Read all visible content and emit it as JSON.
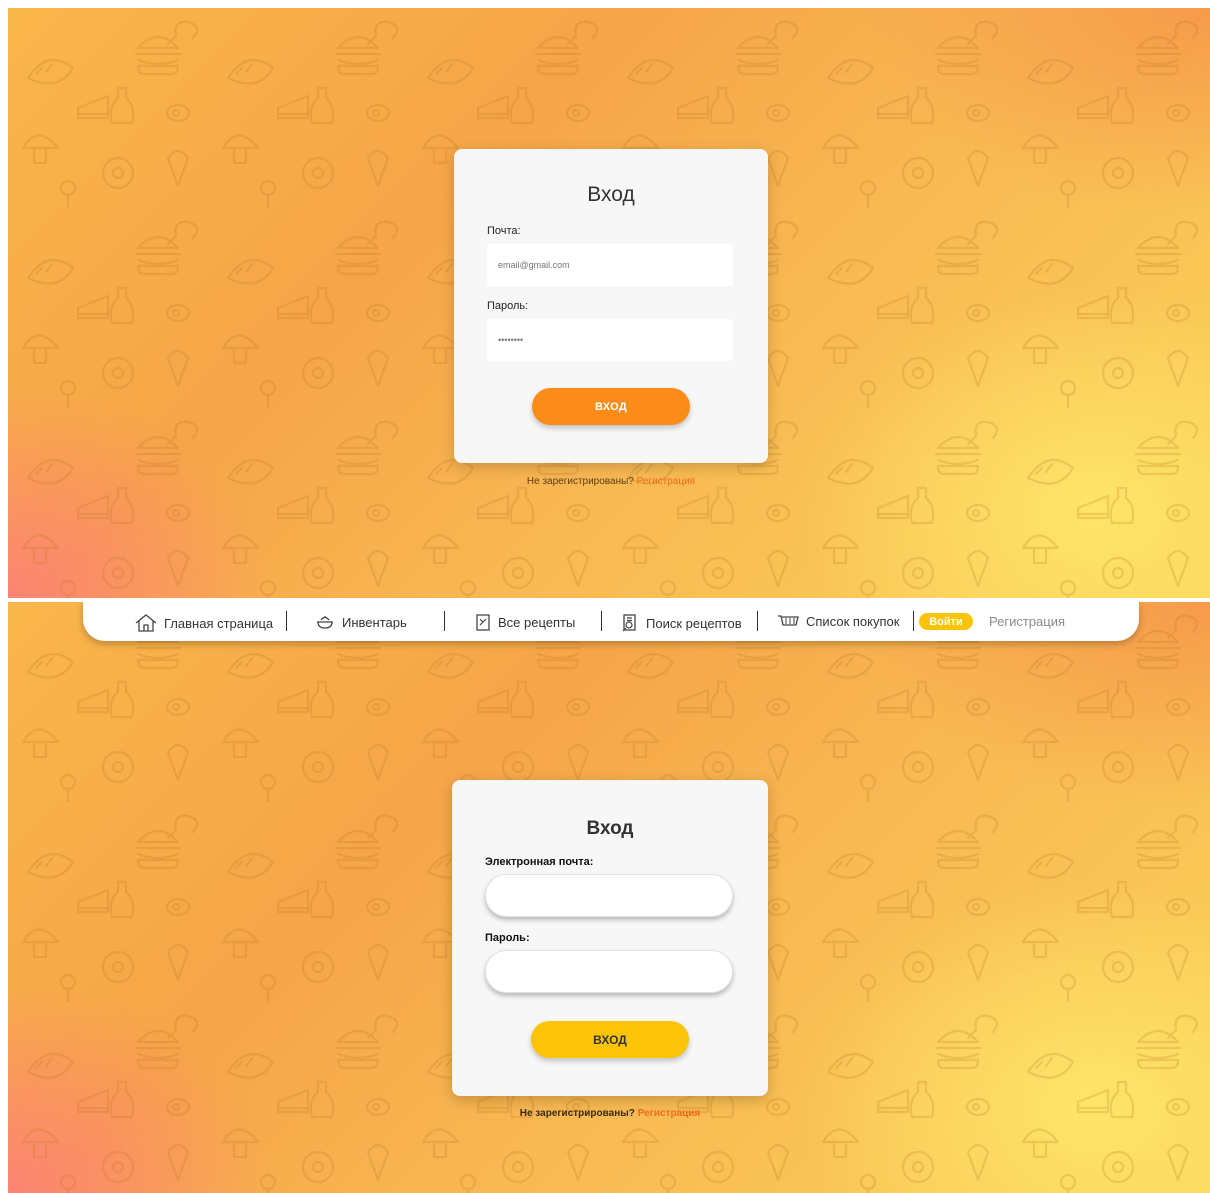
{
  "top_screen": {
    "title": "Вход",
    "email_label": "Почта:",
    "email_placeholder": "email@gmail.com",
    "password_label": "Пароль:",
    "password_placeholder": "••••••••",
    "submit_label": "ВХОД",
    "not_registered_text": "Не зарегистрированы?",
    "register_link": "Регистрация"
  },
  "navbar": {
    "items": [
      {
        "label": "Главная страница",
        "icon": "home-icon"
      },
      {
        "label": "Инвентарь",
        "icon": "pot-icon"
      },
      {
        "label": "Все рецепты",
        "icon": "recipe-book-icon"
      },
      {
        "label": "Поиск рецептов",
        "icon": "recipe-search-icon"
      },
      {
        "label": "Список покупок",
        "icon": "shopping-cart-icon"
      }
    ],
    "login_label": "Войти",
    "register_label": "Регистрация"
  },
  "bottom_screen": {
    "title": "Вход",
    "email_label": "Электронная почта:",
    "email_value": "",
    "password_label": "Пароль:",
    "password_value": "",
    "submit_label": "ВХОД",
    "not_registered_text": "Не зарегистрированы?",
    "register_link": "Регистрация"
  },
  "colors": {
    "top_button": "#fb8c1a",
    "bottom_button": "#fbc409",
    "link": "#ef6a1e",
    "login_pill": "#fbc409"
  }
}
